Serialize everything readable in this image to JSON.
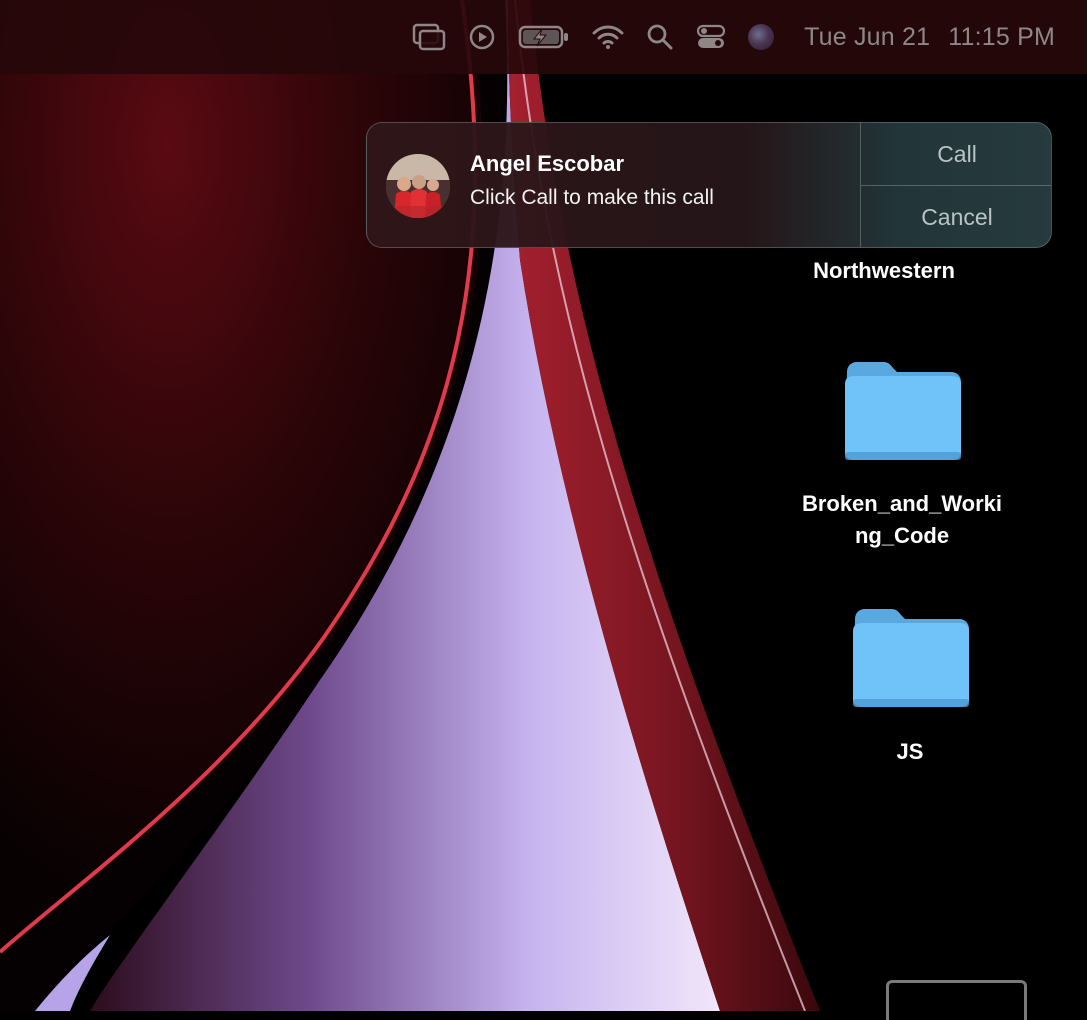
{
  "menubar": {
    "icons": [
      "screen-mirroring-icon",
      "play-icon",
      "battery-charging-icon",
      "wifi-icon",
      "search-icon",
      "control-center-icon",
      "siri-icon"
    ],
    "date": "Tue Jun 21",
    "time": "11:15 PM"
  },
  "notification": {
    "title": "Angel Escobar",
    "message": "Click Call to make this call",
    "call_label": "Call",
    "cancel_label": "Cancel"
  },
  "desktop": {
    "items": [
      {
        "label": "Northwestern",
        "icon": "folder-icon"
      },
      {
        "label_line1": "Broken_and_Worki",
        "label_line2": "ng_Code",
        "icon": "folder-icon"
      },
      {
        "label": "JS",
        "icon": "folder-icon"
      }
    ]
  },
  "colors": {
    "folder": "#6cc2f7",
    "wallpaper_red": "#e03a4c",
    "wallpaper_lavender": "#b6a3e8"
  }
}
